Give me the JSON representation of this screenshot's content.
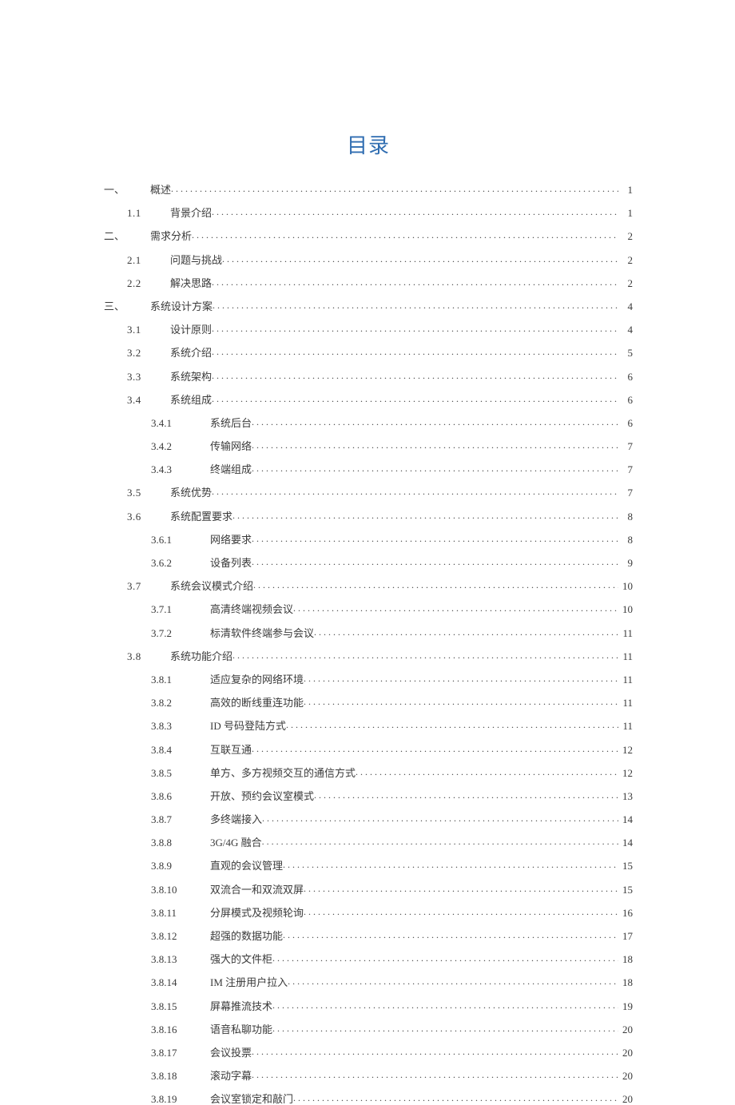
{
  "title": "目录",
  "entries": [
    {
      "level": 1,
      "no": "一、",
      "label": "概述",
      "page": "1"
    },
    {
      "level": 2,
      "no": "1.1",
      "label": "背景介绍",
      "page": "1"
    },
    {
      "level": 1,
      "no": "二、",
      "label": "需求分析",
      "page": "2"
    },
    {
      "level": 2,
      "no": "2.1",
      "label": "问题与挑战",
      "page": "2"
    },
    {
      "level": 2,
      "no": "2.2",
      "label": "解决思路",
      "page": "2"
    },
    {
      "level": 1,
      "no": "三、",
      "label": "系统设计方案",
      "page": "4"
    },
    {
      "level": 2,
      "no": "3.1",
      "label": "设计原则",
      "page": "4"
    },
    {
      "level": 2,
      "no": "3.2",
      "label": "系统介绍",
      "page": "5"
    },
    {
      "level": 2,
      "no": "3.3",
      "label": "系统架构",
      "page": "6"
    },
    {
      "level": 2,
      "no": "3.4",
      "label": "系统组成",
      "page": "6"
    },
    {
      "level": 3,
      "no": "3.4.1",
      "label": "系统后台",
      "page": "6"
    },
    {
      "level": 3,
      "no": "3.4.2",
      "label": "传输网络",
      "page": "7"
    },
    {
      "level": 3,
      "no": "3.4.3",
      "label": "终端组成",
      "page": "7"
    },
    {
      "level": 2,
      "no": "3.5",
      "label": "系统优势",
      "page": "7"
    },
    {
      "level": 2,
      "no": "3.6",
      "label": "系统配置要求",
      "page": "8"
    },
    {
      "level": 3,
      "no": "3.6.1",
      "label": "网络要求",
      "page": "8"
    },
    {
      "level": 3,
      "no": "3.6.2",
      "label": "设备列表",
      "page": "9"
    },
    {
      "level": 2,
      "no": "3.7",
      "label": "系统会议模式介绍",
      "page": "10"
    },
    {
      "level": 3,
      "no": "3.7.1",
      "label": "高清终端视频会议",
      "page": "10"
    },
    {
      "level": 3,
      "no": "3.7.2",
      "label": "标清软件终端参与会议",
      "page": "11"
    },
    {
      "level": 2,
      "no": "3.8",
      "label": "系统功能介绍",
      "page": "11"
    },
    {
      "level": 3,
      "no": "3.8.1",
      "label": "适应复杂的网络环境",
      "page": "11"
    },
    {
      "level": 3,
      "no": "3.8.2",
      "label": "高效的断线重连功能",
      "page": "11"
    },
    {
      "level": 3,
      "no": "3.8.3",
      "label": "ID 号码登陆方式",
      "page": "11"
    },
    {
      "level": 3,
      "no": "3.8.4",
      "label": "互联互通",
      "page": "12"
    },
    {
      "level": 3,
      "no": "3.8.5",
      "label": "单方、多方视频交互的通信方式",
      "page": "12"
    },
    {
      "level": 3,
      "no": "3.8.6",
      "label": "开放、预约会议室模式",
      "page": "13"
    },
    {
      "level": 3,
      "no": "3.8.7",
      "label": "多终端接入",
      "page": "14"
    },
    {
      "level": 3,
      "no": "3.8.8",
      "label": "3G/4G 融合",
      "page": "14"
    },
    {
      "level": 3,
      "no": "3.8.9",
      "label": "直观的会议管理",
      "page": "15"
    },
    {
      "level": 3,
      "no": "3.8.10",
      "label": "双流合一和双流双屏",
      "page": "15"
    },
    {
      "level": 3,
      "no": "3.8.11",
      "label": "分屏模式及视频轮询",
      "page": "16"
    },
    {
      "level": 3,
      "no": "3.8.12",
      "label": "超强的数据功能",
      "page": "17"
    },
    {
      "level": 3,
      "no": "3.8.13",
      "label": "强大的文件柜",
      "page": "18"
    },
    {
      "level": 3,
      "no": "3.8.14",
      "label": "IM 注册用户拉入",
      "page": "18"
    },
    {
      "level": 3,
      "no": "3.8.15",
      "label": "屏幕推流技术",
      "page": "19"
    },
    {
      "level": 3,
      "no": "3.8.16",
      "label": "语音私聊功能",
      "page": "20"
    },
    {
      "level": 3,
      "no": "3.8.17",
      "label": "会议投票",
      "page": "20"
    },
    {
      "level": 3,
      "no": "3.8.18",
      "label": "滚动字幕",
      "page": "20"
    },
    {
      "level": 3,
      "no": "3.8.19",
      "label": "会议室锁定和敲门",
      "page": "20"
    }
  ]
}
